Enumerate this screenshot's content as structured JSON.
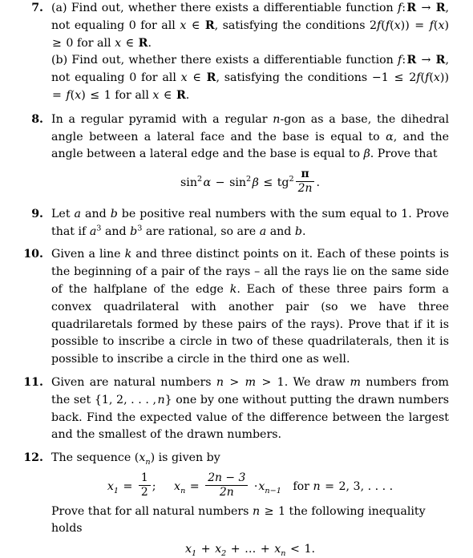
{
  "document": {
    "type": "mathematical-problem-set",
    "page_background": "#ffffff",
    "text_color": "#000000",
    "problems": [
      {
        "number": "7.",
        "parts": [
          {
            "label": "(a)",
            "text": "Find out, whether there exists a differentiable function f : R → R, not equaling 0 for all x ∈ R, satisfying the conditions 2f(f(x)) = f(x) ≥ 0 for all x ∈ R."
          },
          {
            "label": "(b)",
            "text": "Find out, whether there exists a differentiable function f : R → R, not equaling 0 for all x ∈ R, satisfying the conditions −1 ≤ 2f(f(x)) = f(x) ≤ 1 for all x ∈ R."
          }
        ]
      },
      {
        "number": "8.",
        "text": "In a regular pyramid with a regular n-gon as a base, the dihedral angle between a lateral face and the base is equal to α, and the angle between a lateral edge and the base is equal to β. Prove that",
        "display": "sin² α − sin² β ≤ tg² π/(2n) ."
      },
      {
        "number": "9.",
        "text": "Let a and b be positive real numbers with the sum equal to 1. Prove that if a³ and b³ are rational, so are a and b."
      },
      {
        "number": "10.",
        "text": "Given a line k and three distinct points on it. Each of these points is the beginning of a pair of the rays – all the rays lie on the same side of the halfplane of the edge k. Each of these three pairs form a convex quadrilateral with another pair (so we have three quadrilaretals formed by these pairs of the rays). Prove that if it is possible to inscribe a circle in two of these quadrilaterals, then it is possible to inscribe a circle in the third one as well."
      },
      {
        "number": "11.",
        "text": "Given are natural numbers n > m > 1. We draw m numbers from the set {1, 2, … , n} one by one without putting the drawn numbers back. Find the expected value of the difference between the largest and the smallest of the drawn numbers."
      },
      {
        "number": "12.",
        "text": "The sequence (xₙ) is given by",
        "display1": "x₁ = 1/2 ,    xₙ = (2n − 3)/(2n) · xₙ₋₁   for n = 2, 3, … .",
        "text2": "Prove that for all natural numbers n ≥ 1 the following inequality holds",
        "display2": "x₁ + x₂ + … + xₙ < 1."
      }
    ],
    "tokens": {
      "p7a_label": "(a)",
      "p7a_t1": "Find out, whether there exists a differentiable function",
      "p7a_t2": ", not",
      "p7a_t3": "equaling 0 for all",
      "p7a_t4": ", satisfying the conditions",
      "p7a_t5": "for all",
      "p7a_t6": ".",
      "p7b_label": "(b)",
      "p7b_t1": "Find out, whether there exists a differentiable function",
      "p7b_t2": ",",
      "p7b_t3": "not equaling 0 for all",
      "p7b_t4": ", satisfying the conditions",
      "p7b_t5": "for all",
      "p7b_t6": ".",
      "p8_t1": "In a regular pyramid with a regular",
      "p8_t2": "-gon as a base, the dihedral angle",
      "p8_t3": "between a lateral face and the base is equal to",
      "p8_t4": ", and the angle between",
      "p8_t5": "a lateral edge and the base is equal to",
      "p8_t6": ". Prove that",
      "p9_t1": "Let",
      "p9_t2": "and",
      "p9_t3": "be positive real numbers with the sum equal to 1. Prove that",
      "p9_t4": "if",
      "p9_t5": "and",
      "p9_t6": "are rational, so are",
      "p9_t7": "and",
      "p9_t8": ".",
      "p10_t1": "Given a line",
      "p10_t2": "and three distinct points on it. Each of these points is the beginning of a pair of the rays – all the rays lie on the same side of the halfplane of the edge",
      "p10_t3": ". Each of these three pairs form a convex quadrilateral with another pair (so we have three quadrilaretals formed by these pairs of the rays). Prove that if it is possible to inscribe a circle in two of these quadrilaterals, then it is possible to inscribe a circle in the third one as well.",
      "p11_t1": "Given are natural numbers",
      "p11_t2": ". We draw",
      "p11_t3": "numbers from the",
      "p11_t4": "set",
      "p11_t5": "one by one without putting the drawn numbers back.",
      "p11_t6": "Find the expected value of the difference between the largest and the smallest of the drawn numbers.",
      "p12_t1": "The sequence",
      "p12_t2": "is given by",
      "p12_t3": "Prove that for all natural numbers",
      "p12_t4": "the following inequality holds",
      "sym_f": "f",
      "sym_colon": ":",
      "sym_R": "R",
      "sym_arrow": "→",
      "sym_x": "x",
      "sym_in": "∈",
      "sym_2": "2",
      "sym_lparen": "(",
      "sym_rparen": ")",
      "sym_eq": "=",
      "sym_geq": "≥",
      "sym_leq": "≤",
      "sym_0": "0",
      "sym_1": "1",
      "sym_minus1": "−1",
      "sym_n": "n",
      "sym_m": "m",
      "sym_gt": ">",
      "sym_lt": "<",
      "sym_alpha": "α",
      "sym_beta": "β",
      "sym_pi": "π",
      "sym_a": "a",
      "sym_b": "b",
      "sym_k": "k",
      "sym_3": "3",
      "sym_sin": "sin",
      "sym_tg": "tg",
      "sym_minus": "−",
      "sym_plus": "+",
      "sym_cdot": "·",
      "sym_dots": "…",
      "sym_ldots_c": ", . . . ,",
      "sym_set_open": "{",
      "sym_set_close": "}",
      "sym_1c2c": "1, 2",
      "sym_2n": "2n",
      "sym_2n3": "2n − 3",
      "sym_comma": ",",
      "sym_period": ".",
      "sym_semicolon": ";",
      "sym_for": "for",
      "sym_23dots": "2, 3, . . . .",
      "sym_x1": "x",
      "sub_1": "1",
      "sub_2": "2",
      "sub_n": "n",
      "sub_nm1": "n−1"
    }
  }
}
